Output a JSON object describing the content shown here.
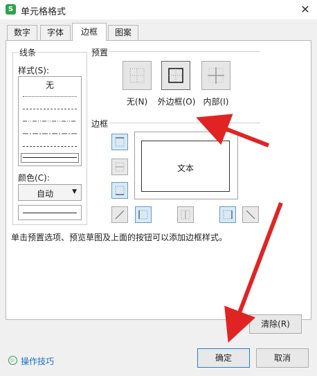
{
  "window": {
    "title": "单元格格式",
    "app_icon_letter": "S",
    "close_symbol": "✕"
  },
  "tabs": [
    {
      "label": "数字"
    },
    {
      "label": "字体"
    },
    {
      "label": "边框"
    },
    {
      "label": "图案"
    }
  ],
  "active_tab": "边框",
  "line_group": {
    "title": "线条",
    "style_label": "样式(S):",
    "none_label": "无",
    "color_label": "颜色(C):",
    "color_value": "自动",
    "dropdown_arrow": "▼"
  },
  "preset_group": {
    "title": "预置",
    "buttons": [
      {
        "label": "无(N)"
      },
      {
        "label": "外边框(O)"
      },
      {
        "label": "内部(I)"
      }
    ]
  },
  "border_group": {
    "title": "边框",
    "preview_text": "文本"
  },
  "hint_text": "单击预置选项、预览草图及上面的按钮可以添加边框样式。",
  "buttons": {
    "clear": "清除(R)",
    "ok": "确定",
    "cancel": "取消"
  },
  "tips": {
    "label": "操作技巧",
    "icon_symbol": "▷"
  },
  "colors": {
    "accent": "#2b7bd1",
    "active_border": "#5b9bd5",
    "arrow": "#e02424",
    "link": "#1a6fd0"
  }
}
